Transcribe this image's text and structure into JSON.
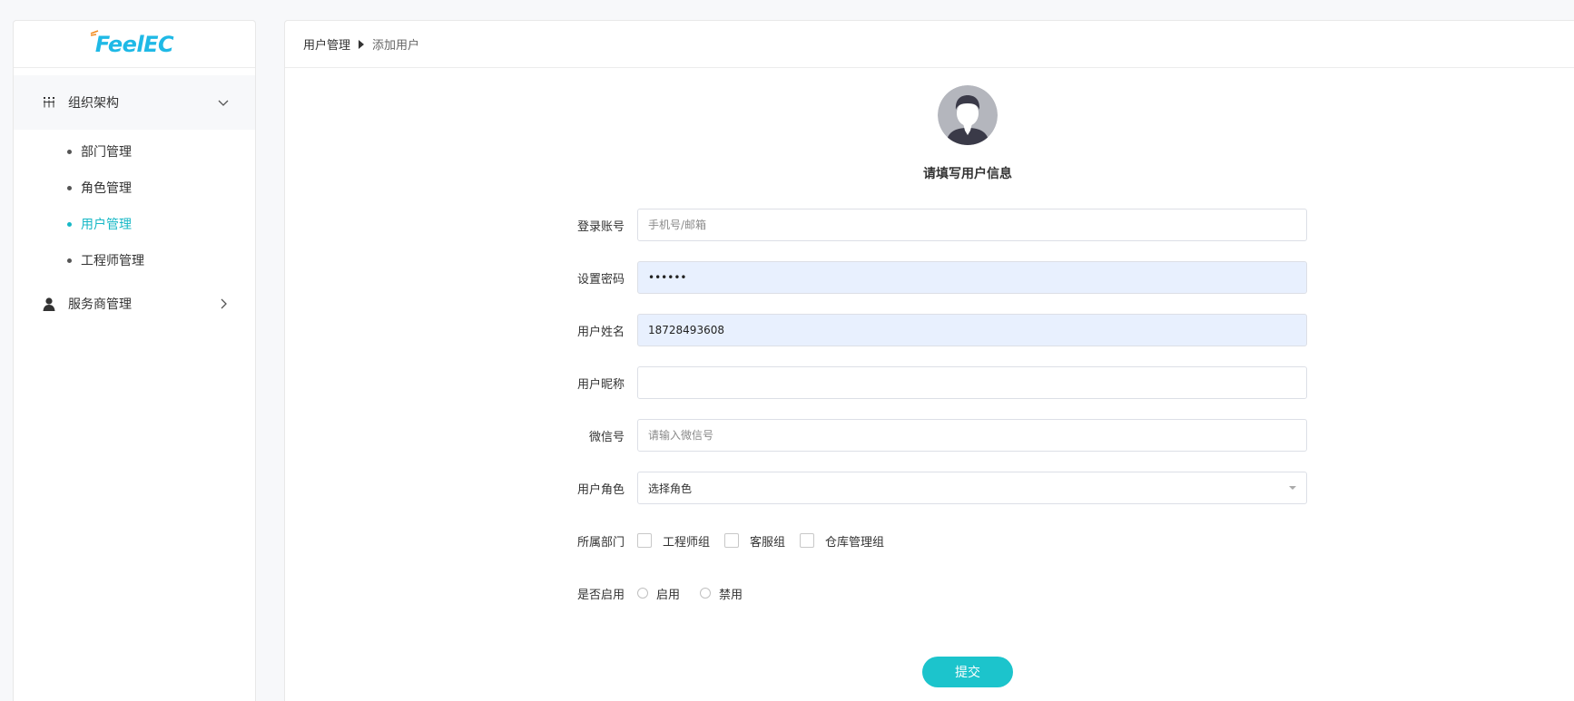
{
  "brand": {
    "logo_text": "FeelEC",
    "accent": "#17b8c6"
  },
  "sidebar": {
    "groups": [
      {
        "label": "组织架构",
        "icon": "org-structure-icon",
        "expanded": true,
        "items": [
          {
            "label": "部门管理",
            "active": false
          },
          {
            "label": "角色管理",
            "active": false
          },
          {
            "label": "用户管理",
            "active": true
          },
          {
            "label": "工程师管理",
            "active": false
          }
        ]
      },
      {
        "label": "服务商管理",
        "icon": "person-icon",
        "expanded": false
      }
    ]
  },
  "breadcrumb": {
    "parent": "用户管理",
    "current": "添加用户"
  },
  "form": {
    "title": "请填写用户信息",
    "fields": {
      "login_account": {
        "label": "登录账号",
        "placeholder": "手机号/邮箱",
        "value": ""
      },
      "password": {
        "label": "设置密码",
        "value": "••••••"
      },
      "real_name": {
        "label": "用户姓名",
        "value": "18728493608"
      },
      "nickname": {
        "label": "用户昵称",
        "value": ""
      },
      "wechat": {
        "label": "微信号",
        "placeholder": "请输入微信号",
        "value": ""
      },
      "role": {
        "label": "用户角色",
        "selected": "选择角色"
      },
      "department": {
        "label": "所属部门",
        "options": [
          "工程师组",
          "客服组",
          "仓库管理组"
        ]
      },
      "enabled": {
        "label": "是否启用",
        "options": [
          "启用",
          "禁用"
        ]
      }
    },
    "submit_label": "提交"
  }
}
